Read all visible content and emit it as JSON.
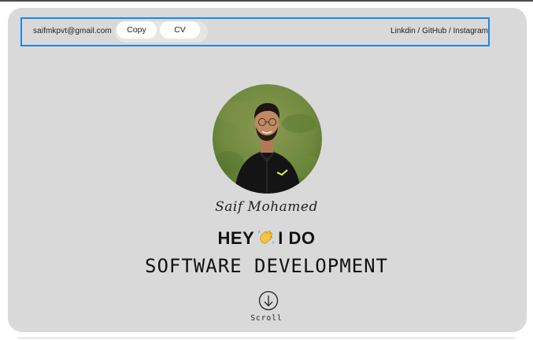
{
  "topbar": {
    "email": "saifmkpvt@gmail.com",
    "copy_label": "Copy",
    "cv_label": "CV",
    "social_linkedin": "Linkdin",
    "social_sep1": " / ",
    "social_github": "GitHub",
    "social_sep2": " / ",
    "social_instagram": "Instagram"
  },
  "hero": {
    "name": "Saif Mohamed",
    "greeting_start": "HEY",
    "greeting_emoji": "waving-hand",
    "greeting_end": "I DO",
    "role": "SOFTWARE DEVELOPMENT",
    "scroll_label": "Scroll",
    "scroll_icon": "arrow-down-circle-icon"
  },
  "colors": {
    "card_bg": "#d9d9d9",
    "highlight_border": "#1e88e5",
    "pill_bg": "#ffffff"
  }
}
